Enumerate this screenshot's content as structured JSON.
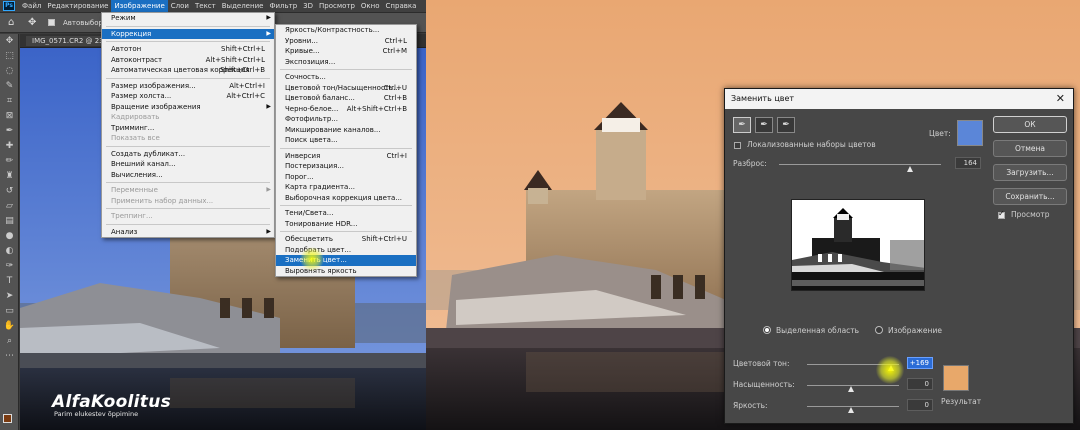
{
  "app": {
    "menubar": [
      "Файл",
      "Редактирование",
      "Изображение",
      "Слои",
      "Текст",
      "Выделение",
      "Фильтр",
      "3D",
      "Просмотр",
      "Окно",
      "Справка"
    ],
    "active_menu_index": 2,
    "options": {
      "autoselect_label": "Автовыбор"
    },
    "document_tab": "IMG_0571.CR2 @ 23,5% (RGB/16*)"
  },
  "image_menu": [
    {
      "label": "Режим",
      "shortcut": "",
      "submenu": true
    },
    {
      "sep": true
    },
    {
      "label": "Коррекция",
      "shortcut": "",
      "submenu": true,
      "highlight": true
    },
    {
      "sep": true
    },
    {
      "label": "Автотон",
      "shortcut": "Shift+Ctrl+L"
    },
    {
      "label": "Автоконтраст",
      "shortcut": "Alt+Shift+Ctrl+L"
    },
    {
      "label": "Автоматическая цветовая коррекция",
      "shortcut": "Shift+Ctrl+B"
    },
    {
      "sep": true
    },
    {
      "label": "Размер изображения...",
      "shortcut": "Alt+Ctrl+I"
    },
    {
      "label": "Размер холста...",
      "shortcut": "Alt+Ctrl+C"
    },
    {
      "label": "Вращение изображения",
      "shortcut": "",
      "submenu": true
    },
    {
      "label": "Кадрировать",
      "shortcut": "",
      "disabled": true
    },
    {
      "label": "Тримминг...",
      "shortcut": ""
    },
    {
      "label": "Показать все",
      "shortcut": "",
      "disabled": true
    },
    {
      "sep": true
    },
    {
      "label": "Создать дубликат...",
      "shortcut": ""
    },
    {
      "label": "Внешний канал...",
      "shortcut": ""
    },
    {
      "label": "Вычисления...",
      "shortcut": ""
    },
    {
      "sep": true
    },
    {
      "label": "Переменные",
      "shortcut": "",
      "submenu": true,
      "disabled": true
    },
    {
      "label": "Применить набор данных...",
      "shortcut": "",
      "disabled": true
    },
    {
      "sep": true
    },
    {
      "label": "Треппинг...",
      "shortcut": "",
      "disabled": true
    },
    {
      "sep": true
    },
    {
      "label": "Анализ",
      "shortcut": "",
      "submenu": true
    }
  ],
  "correction_menu": [
    {
      "label": "Яркость/Контрастность...",
      "shortcut": ""
    },
    {
      "label": "Уровни...",
      "shortcut": "Ctrl+L"
    },
    {
      "label": "Кривые...",
      "shortcut": "Ctrl+M"
    },
    {
      "label": "Экспозиция...",
      "shortcut": ""
    },
    {
      "sep": true
    },
    {
      "label": "Сочность...",
      "shortcut": ""
    },
    {
      "label": "Цветовой тон/Насыщенность...",
      "shortcut": "Ctrl+U"
    },
    {
      "label": "Цветовой баланс...",
      "shortcut": "Ctrl+B"
    },
    {
      "label": "Черно-белое...",
      "shortcut": "Alt+Shift+Ctrl+B"
    },
    {
      "label": "Фотофильтр...",
      "shortcut": ""
    },
    {
      "label": "Микширование каналов...",
      "shortcut": ""
    },
    {
      "label": "Поиск цвета...",
      "shortcut": ""
    },
    {
      "sep": true
    },
    {
      "label": "Инверсия",
      "shortcut": "Ctrl+I"
    },
    {
      "label": "Постеризация...",
      "shortcut": ""
    },
    {
      "label": "Порог...",
      "shortcut": ""
    },
    {
      "label": "Карта градиента...",
      "shortcut": ""
    },
    {
      "label": "Выборочная коррекция цвета...",
      "shortcut": ""
    },
    {
      "sep": true
    },
    {
      "label": "Тени/Света...",
      "shortcut": ""
    },
    {
      "label": "Тонирование HDR...",
      "shortcut": ""
    },
    {
      "sep": true
    },
    {
      "label": "Обесцветить",
      "shortcut": "Shift+Ctrl+U"
    },
    {
      "label": "Подобрать цвет...",
      "shortcut": ""
    },
    {
      "label": "Заменить цвет...",
      "shortcut": "",
      "highlight": true
    },
    {
      "label": "Выровнять яркость",
      "shortcut": ""
    }
  ],
  "dialog": {
    "title": "Заменить цвет",
    "color_label": "Цвет:",
    "selected_color": "#5b86d8",
    "localized_label": "Локализованные наборы цветов",
    "localized_checked": false,
    "fuzziness_label": "Разброс:",
    "fuzziness_value": "164",
    "radio_selection": "Выделенная область",
    "radio_image": "Изображение",
    "radio_selected": "selection",
    "hue_label": "Цветовой тон:",
    "hue_value": "+169",
    "sat_label": "Насыщенность:",
    "sat_value": "0",
    "light_label": "Яркость:",
    "light_value": "0",
    "result_label": "Результат",
    "result_color": "#e8a86a",
    "buttons": {
      "ok": "ОК",
      "cancel": "Отмена",
      "load": "Загрузить...",
      "save": "Сохранить..."
    },
    "preview_label": "Просмотр",
    "preview_checked": true
  },
  "watermark": {
    "line1": "AlfaKoolitus",
    "line2": "Parim elukestev õppimine"
  }
}
